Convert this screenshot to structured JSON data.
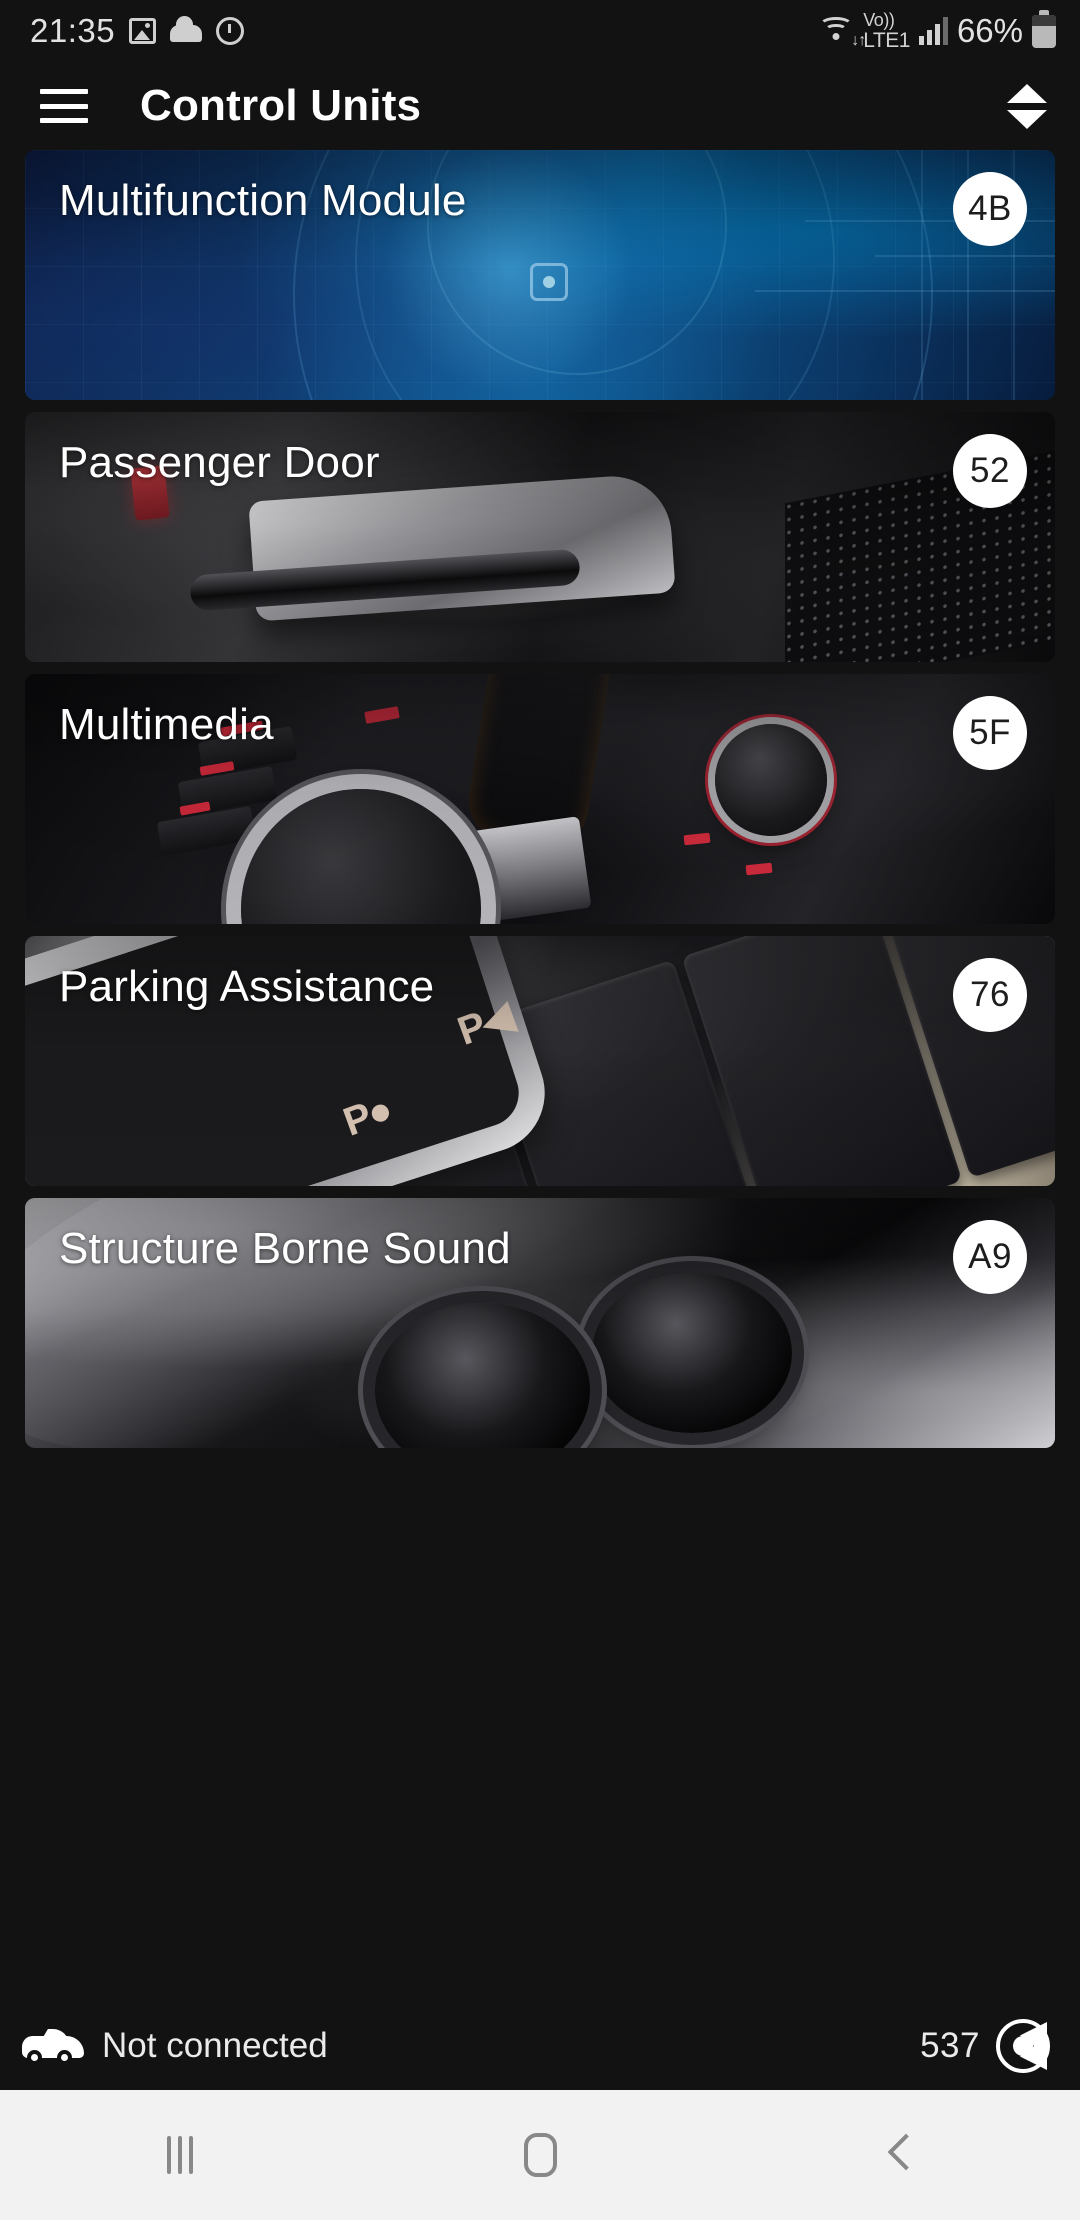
{
  "status_bar": {
    "time": "21:35",
    "icons_left": [
      "gallery-icon",
      "cloud-icon",
      "alarm-icon"
    ],
    "network": {
      "wifi": "wifi-icon",
      "volte_line1": "Vo))",
      "volte_line2": "LTE1",
      "signal": "signal-bars-icon"
    },
    "battery_percent": "66%"
  },
  "app_bar": {
    "menu_icon": "hamburger-menu-icon",
    "title": "Control Units",
    "sort_icon": "sort-updown-icon"
  },
  "control_units": [
    {
      "name": "Multifunction Module",
      "code": "4B",
      "art": "tech"
    },
    {
      "name": "Passenger Door",
      "code": "52",
      "art": "door"
    },
    {
      "name": "Multimedia",
      "code": "5F",
      "art": "mmi"
    },
    {
      "name": "Parking Assistance",
      "code": "76",
      "art": "park"
    },
    {
      "name": "Structure Borne Sound",
      "code": "A9",
      "art": "exh"
    }
  ],
  "bottom_bar": {
    "car_icon": "car-icon",
    "connection_status": "Not connected",
    "count": "537",
    "brand_logo": "carly-logo-icon"
  },
  "nav_bar": {
    "recents": "recents-icon",
    "home": "home-icon",
    "back": "back-icon"
  },
  "colors": {
    "background": "#121212",
    "card_badge_bg": "#ffffff",
    "text_primary": "#ffffff",
    "navbar_bg": "#f2f2f2"
  }
}
